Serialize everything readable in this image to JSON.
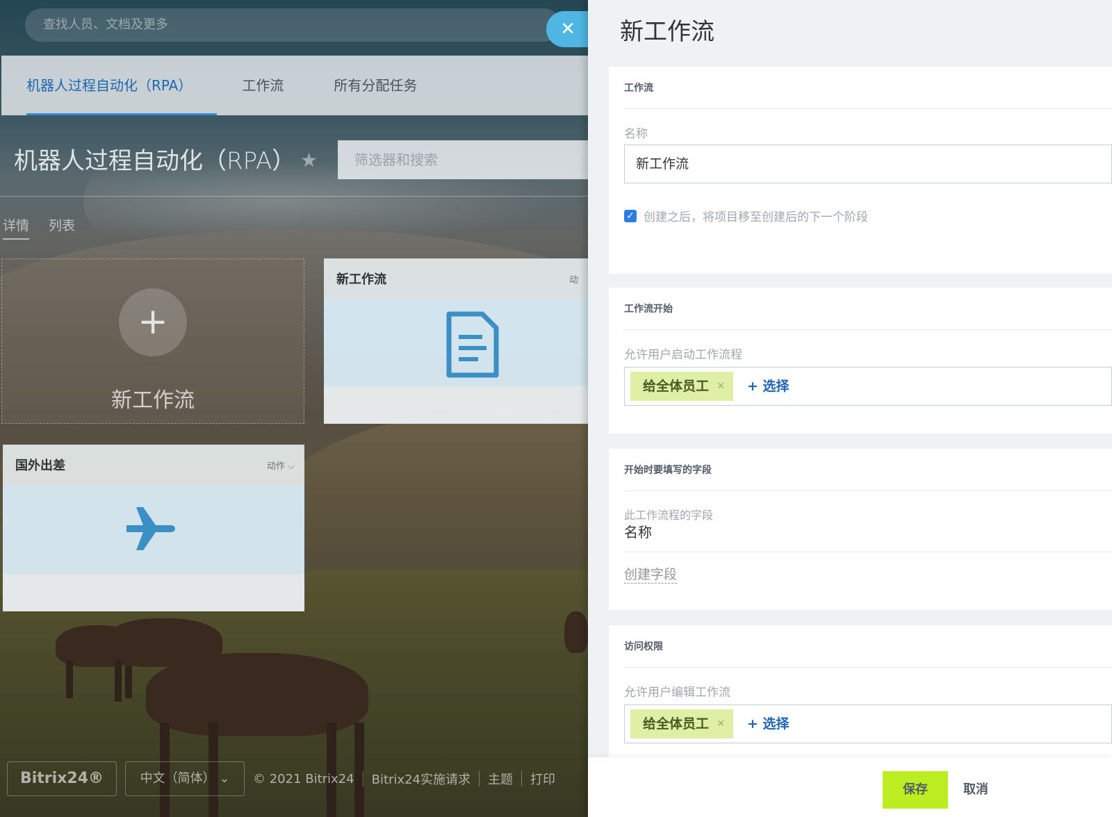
{
  "background": {
    "search_placeholder": "查找人员、文档及更多",
    "tabs": [
      "机器人过程自动化（RPA）",
      "工作流",
      "所有分配任务"
    ],
    "page_title": "机器人过程自动化（RPA）",
    "filter_placeholder": "筛选器和搜索",
    "subtabs": [
      "详情",
      "列表"
    ],
    "add_tile_label": "新工作流",
    "cards": [
      {
        "title": "新工作流",
        "action": "动"
      },
      {
        "title": "国外出差",
        "action": "动作"
      }
    ],
    "footer": {
      "brand": "Bitrix24®",
      "language": "中文（简体）",
      "copyright": "© 2021 Bitrix24",
      "links": [
        "Bitrix24实施请求",
        "主题",
        "打印"
      ]
    }
  },
  "panel": {
    "title": "新工作流",
    "sections": [
      {
        "heading": "工作流",
        "name_label": "名称",
        "name_value": "新工作流",
        "checkbox_label": "创建之后，将项目移至创建后的下一个阶段"
      },
      {
        "heading": "工作流开始",
        "field_label": "允许用户启动工作流程",
        "chip": "给全体员工",
        "select_label": "+ 选择"
      },
      {
        "heading": "开始时要填写的字段",
        "field_label": "此工作流程的字段",
        "field_value": "名称",
        "create_link": "创建字段"
      },
      {
        "heading": "访问权限",
        "field_label": "允许用户编辑工作流",
        "chip": "给全体员工",
        "select_label": "+ 选择"
      }
    ],
    "save_label": "保存",
    "cancel_label": "取消"
  },
  "colors": {
    "accent_blue": "#2066b0",
    "close_button": "#4fb6e4",
    "save_button": "#bbed21",
    "chip_bg": "#dff0a6"
  }
}
